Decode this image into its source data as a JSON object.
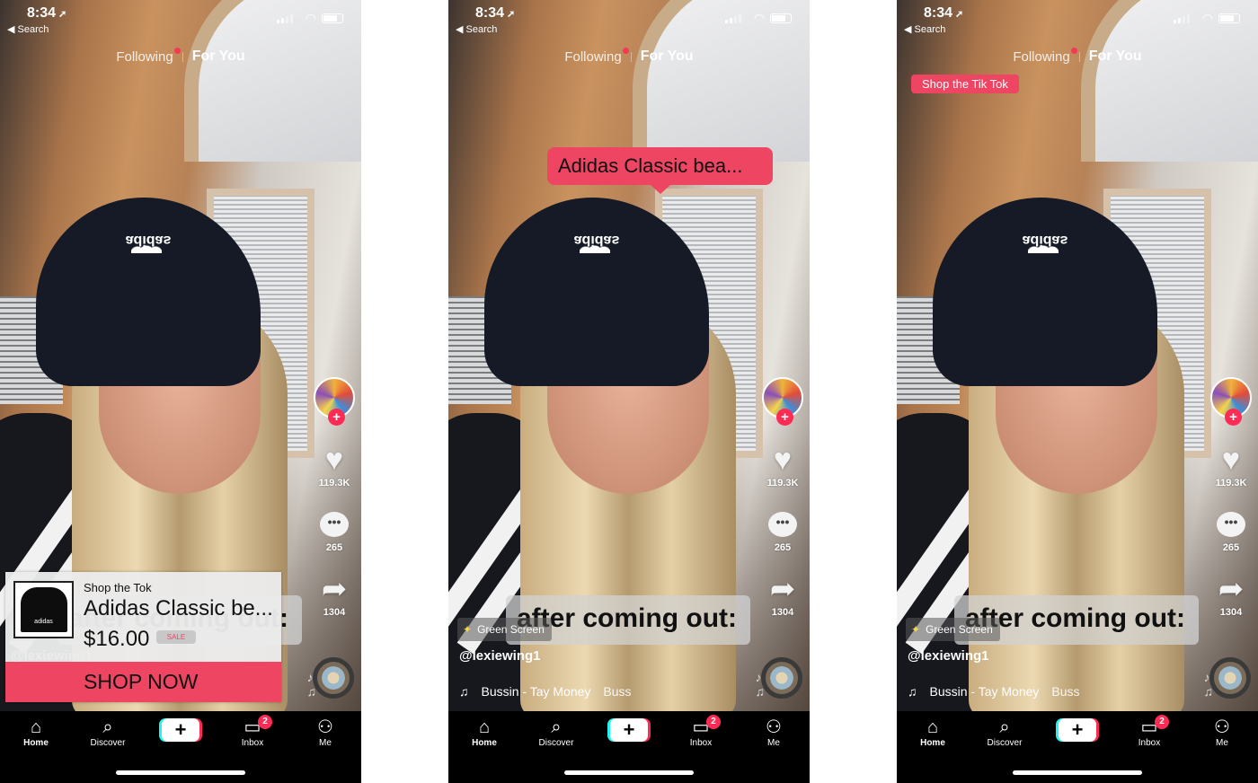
{
  "status_bar": {
    "time": "8:34",
    "back_label": "◀ Search"
  },
  "top_tabs": {
    "following": "Following",
    "for_you": "For You",
    "active": "For You"
  },
  "rail": {
    "likes": "119.3K",
    "comments": "265",
    "shares": "1304"
  },
  "video": {
    "caption": "after coming out:",
    "effect": "Green Screen",
    "username": "@lexiewing1",
    "sound": "Bussin - Tay Money",
    "sound_scroll": "Buss",
    "beanie_text": "adidas"
  },
  "panels": [
    {
      "variant": "shop-card",
      "shop_card": {
        "kicker": "Shop the Tok",
        "title": "Adidas Classic be...",
        "price": "$16.00",
        "badge": "SALE",
        "cta": "SHOP NOW",
        "thumb_text": "adidas"
      }
    },
    {
      "variant": "tooltip",
      "tooltip": {
        "text": "Adidas Classic bea..."
      }
    },
    {
      "variant": "chip",
      "chip": {
        "text": "Shop the Tik Tok"
      }
    }
  ],
  "nav": {
    "items": [
      {
        "label": "Home",
        "icon": "home-icon",
        "active": true
      },
      {
        "label": "Discover",
        "icon": "search-icon"
      },
      {
        "label": "",
        "icon": "plus-icon"
      },
      {
        "label": "Inbox",
        "icon": "inbox-icon",
        "badge": "2"
      },
      {
        "label": "Me",
        "icon": "profile-icon"
      }
    ]
  },
  "colors": {
    "accent": "#fe2c55",
    "shop_pink": "#ed4562",
    "cyan": "#25f4ee"
  }
}
